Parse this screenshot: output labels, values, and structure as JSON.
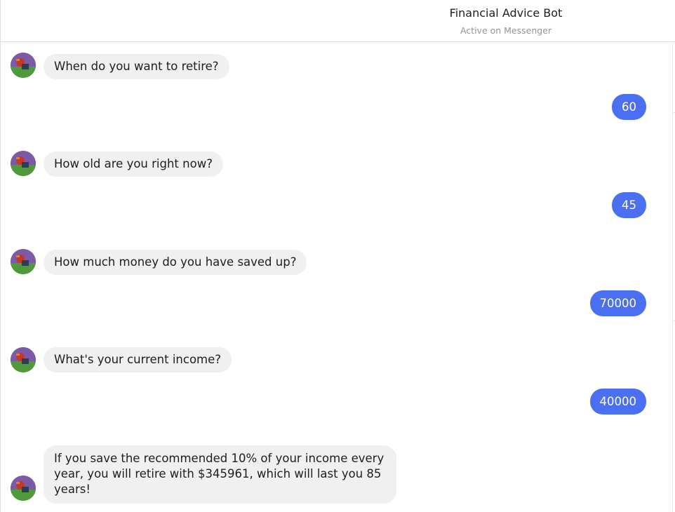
{
  "header": {
    "title": "Financial Advice Bot",
    "status": "Active on Messenger"
  },
  "bot": {
    "avatar_icon": "bot-avatar-icon"
  },
  "colors": {
    "outgoing_bubble": "#4a6ff0",
    "incoming_bubble": "#f1f0f0"
  },
  "messages": [
    {
      "from": "bot",
      "text": "When do you want to retire?"
    },
    {
      "from": "user",
      "text": "60"
    },
    {
      "from": "bot",
      "text": "How old are you right now?"
    },
    {
      "from": "user",
      "text": "45"
    },
    {
      "from": "bot",
      "text": "How much money do you have saved up?"
    },
    {
      "from": "user",
      "text": "70000"
    },
    {
      "from": "bot",
      "text": "What's your current income?"
    },
    {
      "from": "user",
      "text": "40000"
    },
    {
      "from": "bot",
      "text": "If you save the recommended 10% of your income every year, you will retire with $345961, which will last you 85 years!"
    }
  ]
}
